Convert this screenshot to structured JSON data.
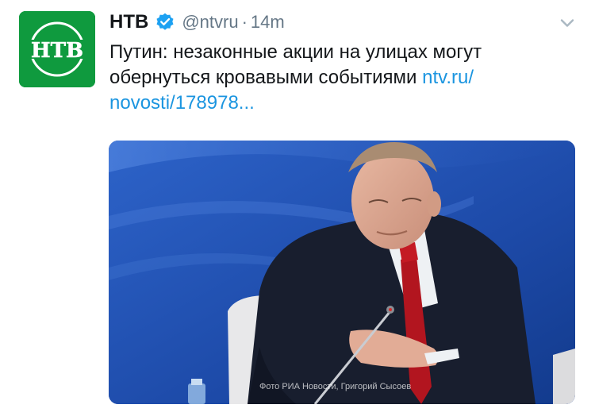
{
  "tweet": {
    "display_name": "НТВ",
    "handle": "@ntvru",
    "separator": "·",
    "time": "14m",
    "avatar_logo_text": "НТВ",
    "text_line1": "Путин: незаконные акции на улицах могут",
    "text_line2": "обернуться кровавыми событиями",
    "link_part1": "ntv.ru/",
    "link_part2": "novosti/178978..."
  },
  "media": {
    "photo_credit": "Фото РИА Новости, Григорий Сысоев"
  },
  "icons": {
    "verified": "verified-badge-icon",
    "menu": "chevron-down-icon"
  },
  "colors": {
    "link": "#1b95e0",
    "verified": "#1da1f2",
    "avatar_bg": "#0f9a3e",
    "secondary_text": "#657786"
  }
}
